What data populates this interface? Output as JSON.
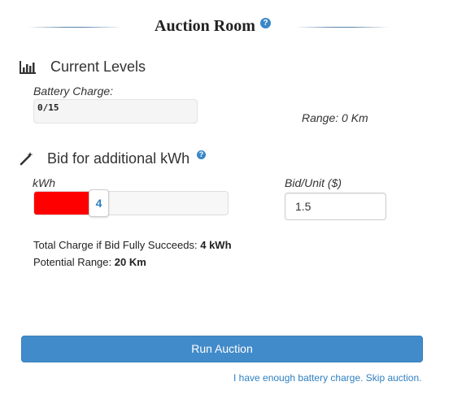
{
  "header": {
    "title": "Auction Room",
    "help_glyph": "?"
  },
  "current_levels": {
    "icon": "bar-chart-icon",
    "title": "Current Levels",
    "battery_label": "Battery Charge:",
    "battery_value": "0/15",
    "range_text": "Range: 0 Km"
  },
  "bid": {
    "icon": "magic-wand-icon",
    "title": "Bid for additional kWh",
    "help_glyph": "?",
    "kwh_label": "kWh",
    "kwh_value": "4",
    "kwh_fill_fraction": 0.16,
    "kwh_fill_color": "#ff0000",
    "bid_unit_label": "Bid/Unit ($)",
    "bid_unit_value": "1.5"
  },
  "summary": {
    "total_charge_label": "Total Charge if Bid Fully Succeeds:",
    "total_charge_value": "4 kWh",
    "potential_range_label": "Potential Range:",
    "potential_range_value": "20 Km"
  },
  "actions": {
    "run_label": "Run Auction",
    "skip_link": "I have enough battery charge. Skip auction."
  },
  "colors": {
    "accent": "#428bca",
    "link": "#2f7fc1"
  }
}
